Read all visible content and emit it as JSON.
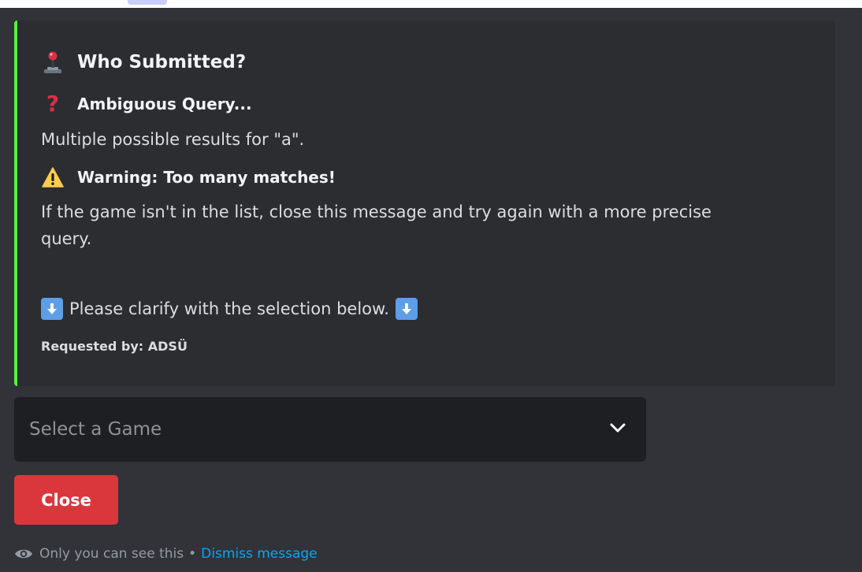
{
  "embed": {
    "accent_color": "#57f240",
    "title": "Who Submitted?",
    "title_icon": "joystick-icon",
    "fields": [
      {
        "icon": "question-mark-icon",
        "name": "Ambiguous Query...",
        "value": "Multiple possible results for \"a\"."
      },
      {
        "icon": "warning-icon",
        "name": "Warning: Too many matches!",
        "value_line1": "If the game isn't in the list, close this message and try again with a more precise",
        "value_line2": "query."
      }
    ],
    "instruction": "Please clarify with the selection below.",
    "instruction_icon": "arrow-down-icon",
    "footer": "Requested by: ADSÜ"
  },
  "select": {
    "placeholder": "Select a Game",
    "icon": "chevron-down-icon"
  },
  "close_button": {
    "label": "Close",
    "color": "#da373c"
  },
  "ephemeral": {
    "icon": "eye-icon",
    "text": "Only you can see this",
    "separator": "•",
    "dismiss_label": "Dismiss message",
    "link_color": "#00a8fc"
  }
}
